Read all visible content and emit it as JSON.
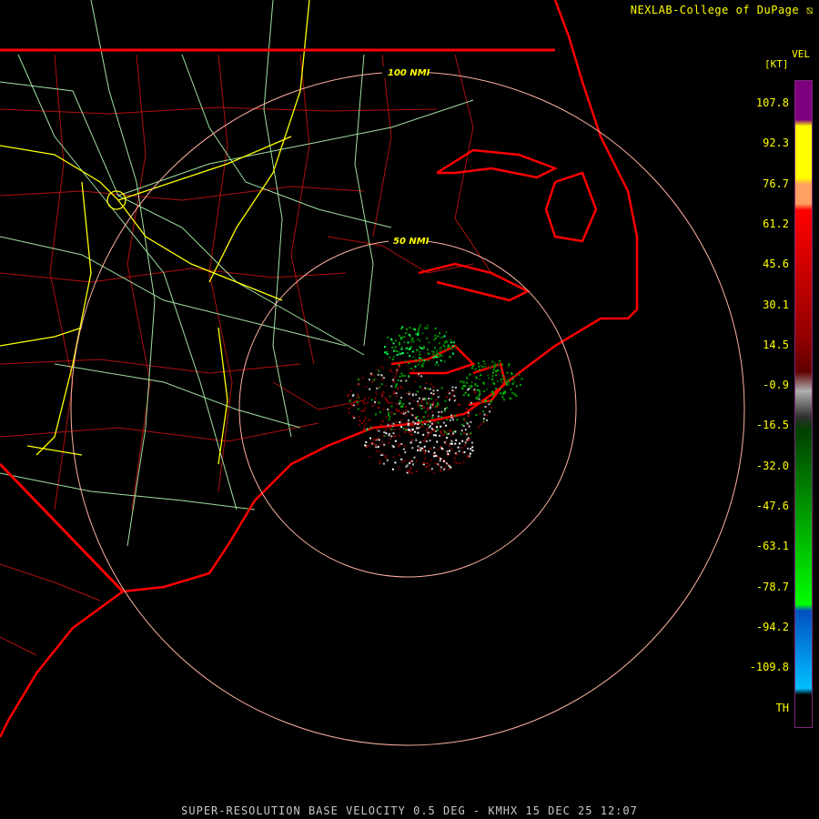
{
  "header": {
    "credit": "NEXLAB-College of DuPage"
  },
  "footer": {
    "caption": "SUPER-RESOLUTION BASE VELOCITY 0.5 DEG - KMHX 15 DEC 25 12:07"
  },
  "colorbar": {
    "title": "VEL",
    "unit": "[KT]",
    "labels": [
      "107.8",
      "92.3",
      "76.7",
      "61.2",
      "45.6",
      "30.1",
      "14.5",
      "-0.9",
      "-16.5",
      "-32.0",
      "-47.6",
      "-63.1",
      "-78.7",
      "-94.2",
      "-109.8",
      "TH"
    ],
    "colors": {
      "purple": "#7f007f",
      "yellow": "#ffff00",
      "orange": "#ffa060",
      "red": "#ff0000",
      "dark_red": "#600000",
      "gray": "#b0b0b0",
      "dark_green": "#004000",
      "green": "#00ff00",
      "blue": "#0050c0",
      "light_blue": "#00c0ff"
    }
  },
  "range_rings": [
    {
      "label": "50 NMI"
    },
    {
      "label": "100 NMI"
    }
  ],
  "map_colors": {
    "state_borders": "#ff0000",
    "county_lines": "#b01010",
    "roads": "#a0e0a0",
    "interstates": "#ffff00",
    "rings": "#ffb0a0"
  }
}
